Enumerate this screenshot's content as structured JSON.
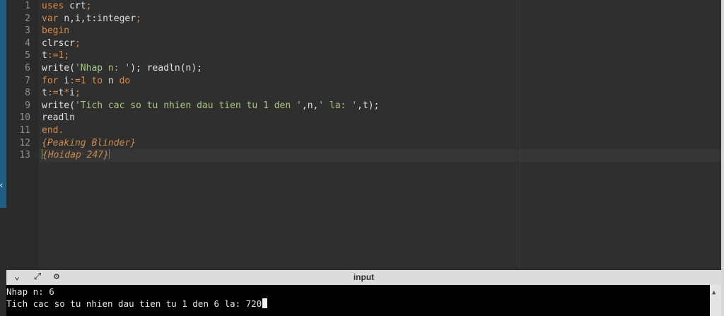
{
  "editor": {
    "lines": [
      {
        "num": "1",
        "parts": [
          {
            "t": "uses ",
            "c": "kw"
          },
          {
            "t": "crt",
            "c": "id"
          },
          {
            "t": ";",
            "c": "kw"
          }
        ]
      },
      {
        "num": "2",
        "parts": [
          {
            "t": "var ",
            "c": "kw"
          },
          {
            "t": "n,i,t:integer",
            "c": "id"
          },
          {
            "t": ";",
            "c": "kw"
          }
        ]
      },
      {
        "num": "3",
        "parts": [
          {
            "t": "begin",
            "c": "kw"
          }
        ]
      },
      {
        "num": "4",
        "parts": [
          {
            "t": "clrscr",
            "c": "id"
          },
          {
            "t": ";",
            "c": "kw"
          }
        ]
      },
      {
        "num": "5",
        "parts": [
          {
            "t": "t",
            "c": "id"
          },
          {
            "t": ":=",
            "c": "kw"
          },
          {
            "t": "1",
            "c": "num"
          },
          {
            "t": ";",
            "c": "kw"
          }
        ]
      },
      {
        "num": "6",
        "parts": [
          {
            "t": "write(",
            "c": "id"
          },
          {
            "t": "'Nhap n: '",
            "c": "str"
          },
          {
            "t": "); readln(n);",
            "c": "id"
          }
        ]
      },
      {
        "num": "7",
        "parts": [
          {
            "t": "for ",
            "c": "kw"
          },
          {
            "t": "i",
            "c": "id"
          },
          {
            "t": ":=",
            "c": "kw"
          },
          {
            "t": "1 ",
            "c": "num"
          },
          {
            "t": "to ",
            "c": "kw"
          },
          {
            "t": "n ",
            "c": "id"
          },
          {
            "t": "do",
            "c": "kw"
          }
        ]
      },
      {
        "num": "8",
        "parts": [
          {
            "t": "t",
            "c": "id"
          },
          {
            "t": ":=",
            "c": "kw"
          },
          {
            "t": "t",
            "c": "id"
          },
          {
            "t": "*",
            "c": "kw"
          },
          {
            "t": "i",
            "c": "id"
          },
          {
            "t": ";",
            "c": "kw"
          }
        ]
      },
      {
        "num": "9",
        "parts": [
          {
            "t": "write(",
            "c": "id"
          },
          {
            "t": "'Tich cac so tu nhien dau tien tu 1 den '",
            "c": "str"
          },
          {
            "t": ",n,",
            "c": "id"
          },
          {
            "t": "' la: '",
            "c": "str"
          },
          {
            "t": ",t);",
            "c": "id"
          }
        ]
      },
      {
        "num": "10",
        "parts": [
          {
            "t": "readln",
            "c": "id"
          }
        ]
      },
      {
        "num": "11",
        "parts": [
          {
            "t": "end.",
            "c": "kw"
          }
        ]
      },
      {
        "num": "12",
        "parts": [
          {
            "t": "{Peaking Blinder}",
            "c": "cm"
          }
        ]
      },
      {
        "num": "13",
        "parts": [
          {
            "t": "{Hoidap 247}",
            "c": "cm"
          }
        ],
        "cursor": true
      }
    ]
  },
  "panel": {
    "title": "input",
    "tools": [
      {
        "name": "collapse-icon",
        "glyph": "⌄"
      },
      {
        "name": "expand-icon",
        "glyph": "⤢"
      },
      {
        "name": "gear-icon",
        "glyph": "⚙"
      }
    ]
  },
  "console": {
    "lines": [
      "Nhap n: 6",
      "Tich cac so tu nhien dau tien tu 1 den 6 la: 720"
    ]
  },
  "colors": {
    "keyword": "#d98a44",
    "identifier": "#e1e1e1",
    "string": "#a9c97d",
    "comment": "#cc8b4c",
    "line_number": "#8f8f8f"
  }
}
